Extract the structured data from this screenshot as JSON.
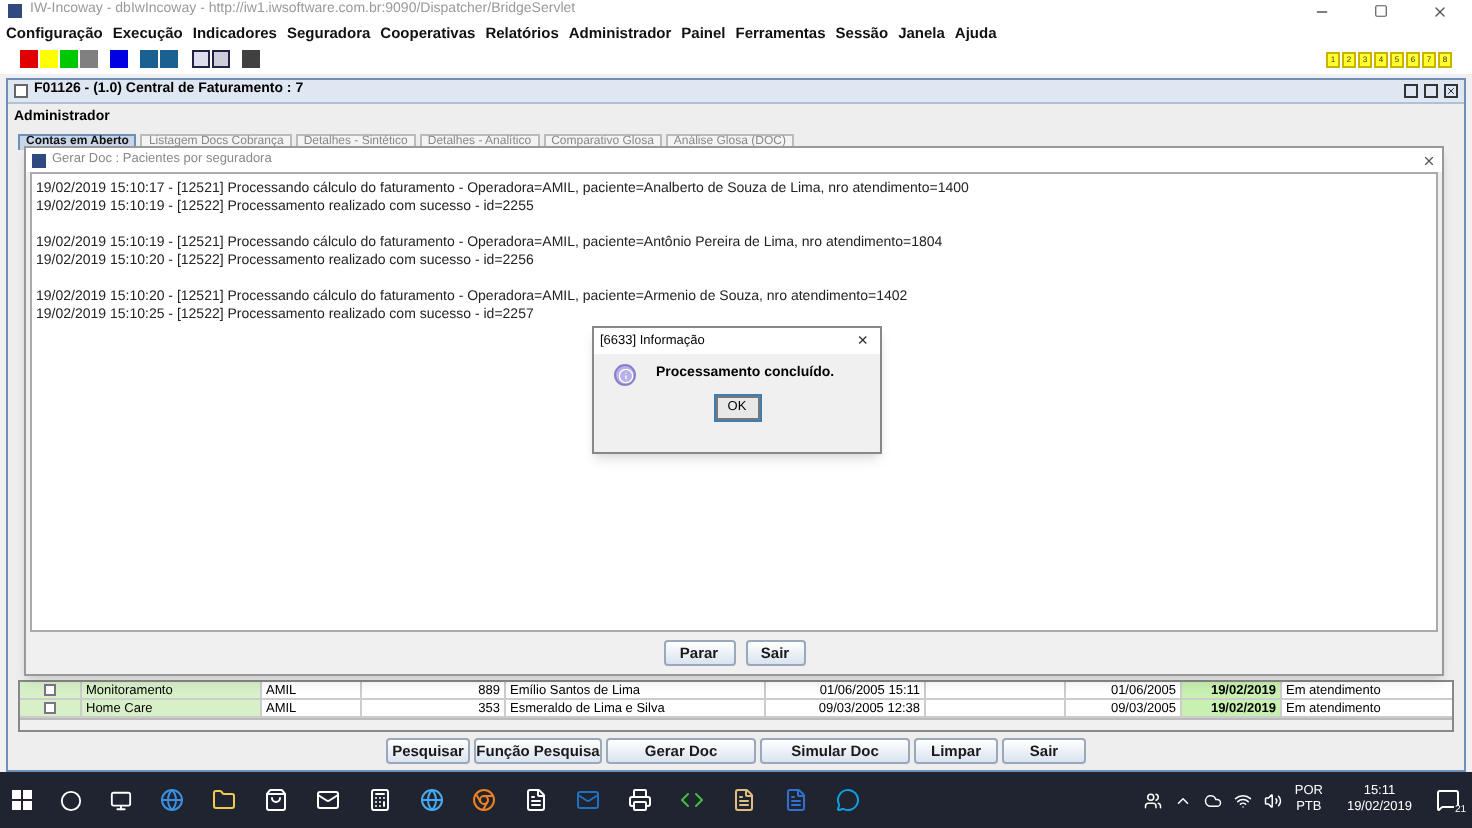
{
  "window": {
    "title": "IW-Incoway - dbIwIncoway - http://iw1.iwsoftware.com.br:9090/Dispatcher/BridgeServlet"
  },
  "menu": [
    "Configuração",
    "Execução",
    "Indicadores",
    "Seguradora",
    "Cooperativas",
    "Relatórios",
    "Administrador",
    "Painel",
    "Ferramentas",
    "Sessão",
    "Janela",
    "Ajuda"
  ],
  "toolbar": {
    "swatches": [
      {
        "color": "#e00000"
      },
      {
        "color": "#ffff00"
      },
      {
        "color": "#00c800"
      },
      {
        "color": "#808080"
      },
      {
        "color": "#0000e0"
      },
      {
        "color": "#1a6090"
      },
      {
        "color": "#1a6090"
      }
    ],
    "end_swatch": {
      "color": "#404040"
    },
    "window_buttons": [
      "1",
      "2",
      "3",
      "4",
      "5",
      "6",
      "7",
      "8"
    ]
  },
  "frame": {
    "title": "F01126 - (1.0) Central de Faturamento : 7",
    "user": "Administrador",
    "tabs": [
      {
        "label": "Contas em Aberto",
        "selected": true
      },
      {
        "label": "Listagem Docs Cobrança",
        "selected": false
      },
      {
        "label": "Detalhes - Sintético",
        "selected": false
      },
      {
        "label": "Detalhes - Analítico",
        "selected": false
      },
      {
        "label": "Comparativo Glosa",
        "selected": false
      },
      {
        "label": "Análise Glosa (DOC)",
        "selected": false
      }
    ],
    "table": {
      "rows": [
        {
          "checked": false,
          "cells": [
            "Monitoramento",
            "AMIL",
            "889",
            "Emílio Santos de Lima",
            "01/06/2005 15:11",
            "01/06/2005",
            "19/02/2019",
            "Em atendimento"
          ]
        },
        {
          "checked": false,
          "cells": [
            "Home Care",
            "AMIL",
            "353",
            "Esmeraldo de Lima e Silva",
            "09/03/2005 12:38",
            "09/03/2005",
            "19/02/2019",
            "Em atendimento"
          ]
        }
      ]
    },
    "buttons": [
      "Pesquisar",
      "Função Pesquisa",
      "Gerar Doc",
      "Simular Doc",
      "Limpar",
      "Sair"
    ]
  },
  "log_dialog": {
    "title": "Gerar Doc : Pacientes por seguradora",
    "entries": [
      [
        "19/02/2019 15:10:17 - [12521] Processando cálculo do faturamento - Operadora=AMIL, paciente=Analberto de Souza de Lima, nro atendimento=1400",
        "19/02/2019 15:10:19 - [12522] Processamento realizado com sucesso - id=2255"
      ],
      [
        "19/02/2019 15:10:19 - [12521] Processando cálculo do faturamento - Operadora=AMIL, paciente=Antônio Pereira de Lima, nro atendimento=1804",
        "19/02/2019 15:10:20 - [12522] Processamento realizado com sucesso - id=2256"
      ],
      [
        "19/02/2019 15:10:20 - [12521] Processando cálculo do faturamento - Operadora=AMIL, paciente=Armenio de Souza, nro atendimento=1402",
        "19/02/2019 15:10:25 - [12522] Processamento realizado com sucesso - id=2257"
      ]
    ],
    "buttons": [
      "Parar",
      "Sair"
    ]
  },
  "info_dialog": {
    "title": "[6633] Informação",
    "close": "×",
    "message": "Processamento concluído.",
    "button": "OK"
  },
  "taskbar": {
    "language": "POR",
    "layout": "PTB",
    "time": "15:11",
    "date": "19/02/2019",
    "notifications": "21"
  }
}
